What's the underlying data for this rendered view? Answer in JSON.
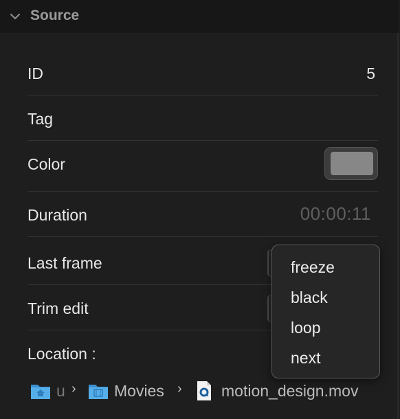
{
  "header": {
    "title": "Source",
    "chevron_icon": "chevron-down-icon"
  },
  "rows": {
    "id_label": "ID",
    "id_value": "5",
    "tag_label": "Tag",
    "color_label": "Color",
    "color_value": "#878787",
    "duration_label": "Duration",
    "duration_value": "00:00:11",
    "last_frame_label": "Last frame",
    "trim_edit_label": "Trim edit",
    "location_label": "Location :"
  },
  "menu": {
    "items": [
      {
        "label": "freeze"
      },
      {
        "label": "black"
      },
      {
        "label": "loop"
      },
      {
        "label": "next"
      }
    ]
  },
  "path": {
    "segments": [
      {
        "label": "u",
        "icon": "home-folder-icon"
      },
      {
        "label": "Movies",
        "icon": "movies-folder-icon"
      },
      {
        "label": "motion_design.mov",
        "icon": "quicktime-file-icon"
      }
    ],
    "separator": "›"
  },
  "colors": {
    "background": "#1e1e1e",
    "header_bg": "#171717",
    "folder_blue": "#4aa3e0"
  }
}
